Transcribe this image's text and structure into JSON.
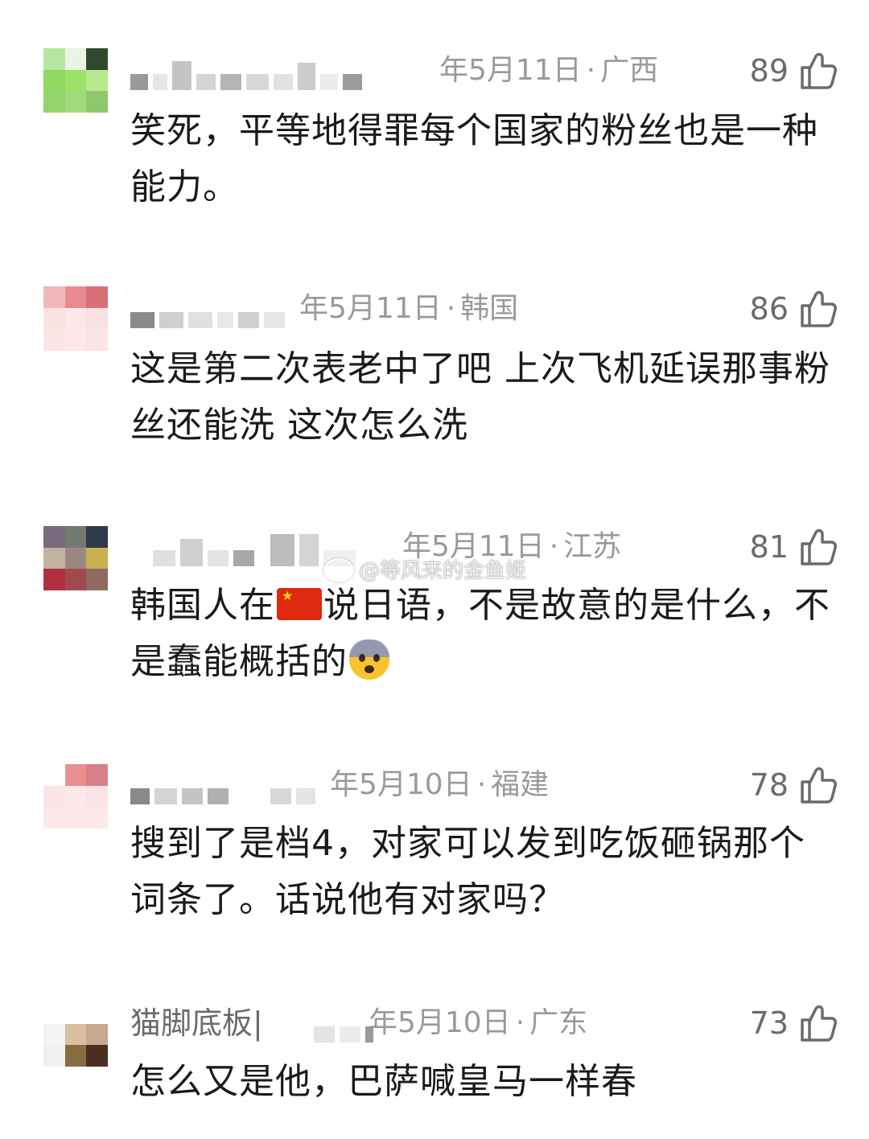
{
  "comments": [
    {
      "username": "",
      "date": "年5月11日",
      "location": "广西",
      "likes": "89",
      "text": "笑死，平等地得罪每个国家的粉丝也是一种能力。",
      "avatar_colors": [
        "#b7e6a0",
        "#e8f4e4",
        "#2e4a2e",
        "#8fd862",
        "#9de06a",
        "#b8ea8e",
        "#92d46a",
        "#a0da7c",
        "#8cc86c"
      ]
    },
    {
      "username": "",
      "date": "年5月11日",
      "location": "韩国",
      "likes": "86",
      "text": "这是第二次表老中了吧 上次飞机延误那事粉丝还能洗 这次怎么洗",
      "avatar_colors": [
        "#f0b8b8",
        "#e88a90",
        "#d8707a",
        "#fbe2e2",
        "#fde8e8",
        "#fbe0e2",
        "#fbe6e6",
        "#fde8ea",
        "#fbe4e6"
      ]
    },
    {
      "username": "",
      "date": "年5月11日",
      "location": "江苏",
      "likes": "81",
      "text_before_flag": "韩国人在",
      "text_after_flag": "说日语，不是故意的是什么，不是蠢能概括的",
      "avatar_colors": [
        "#7a6a80",
        "#707a72",
        "#2c3a4a",
        "#c0b4a0",
        "#9a8880",
        "#c8b050",
        "#b03040",
        "#a04a50",
        "#906a60"
      ]
    },
    {
      "username": "",
      "date": "年5月10日",
      "location": "福建",
      "likes": "78",
      "text": "搜到了是档4，对家可以发到吃饭砸锅那个词条了。话说他有对家吗？",
      "avatar_colors": [
        "#ffffff",
        "#e89090",
        "#d88088",
        "#fbe4e8",
        "#fde8ea",
        "#fbe4e8",
        "#fde8ea",
        "#fbe6ea",
        "#fde8ea"
      ]
    },
    {
      "username": "猫脚底板|",
      "date": "年5月10日",
      "location": "广东",
      "likes": "73",
      "text": "怎么又是他，巴萨喊皇马一样春",
      "avatar_colors": [
        "#ffffff",
        "#ffffff",
        "#ffffff",
        "#ffffff",
        "#ffffff",
        "#ffffff",
        "#d8c0a0",
        "#c8a890",
        "#8a6a40"
      ]
    }
  ],
  "watermark": "@等风来的金鱼姬"
}
